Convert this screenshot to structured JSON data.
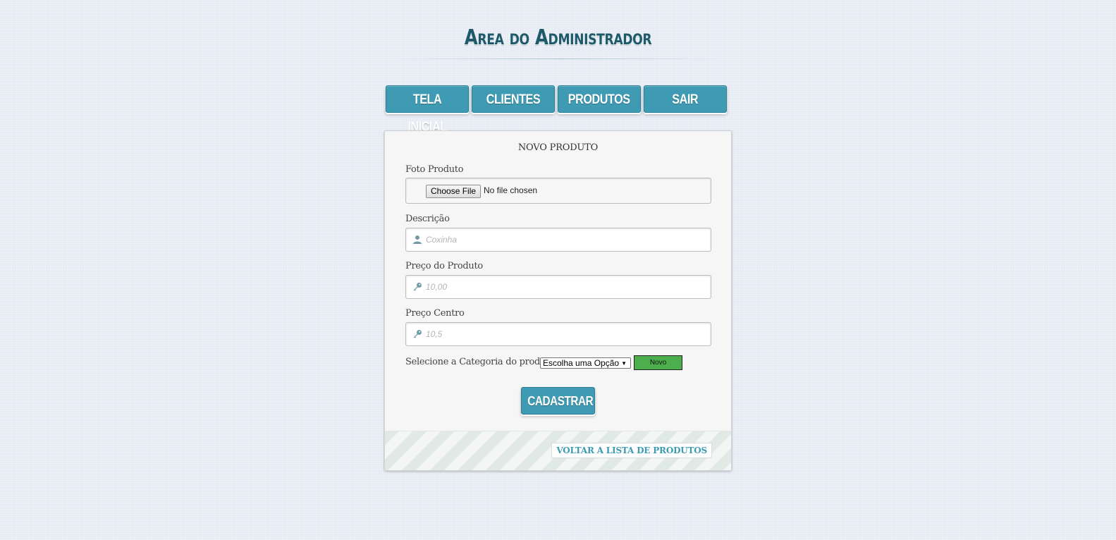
{
  "header": {
    "title": "Area do Administrador"
  },
  "nav": {
    "items": [
      {
        "label": "TELA INICIAL"
      },
      {
        "label": "CLIENTES"
      },
      {
        "label": "PRODUTOS"
      },
      {
        "label": "SAIR"
      }
    ]
  },
  "form": {
    "title": "NOVO PRODUTO",
    "photo": {
      "label": "Foto Produto",
      "button_label": "Choose File",
      "status": "No file chosen"
    },
    "description": {
      "label": "Descrição",
      "placeholder": "Coxinha",
      "icon": "user-icon"
    },
    "price": {
      "label": "Preço do Produto",
      "placeholder": "10,00",
      "icon": "key-icon"
    },
    "center_price": {
      "label": "Preço Centro",
      "placeholder": "10,5",
      "icon": "key-icon"
    },
    "category": {
      "label": "Selecione a Categoria do produto",
      "selected": "Escolha uma Opção",
      "new_button": "Novo"
    },
    "submit_label": "CADASTRAR",
    "back_link": "VOLTAR A LISTA DE PRODUTOS"
  },
  "colors": {
    "accent": "#3f9bb3",
    "title": "#1e5a6a",
    "new_button": "#4cae4c",
    "background": "#e9eef5"
  }
}
